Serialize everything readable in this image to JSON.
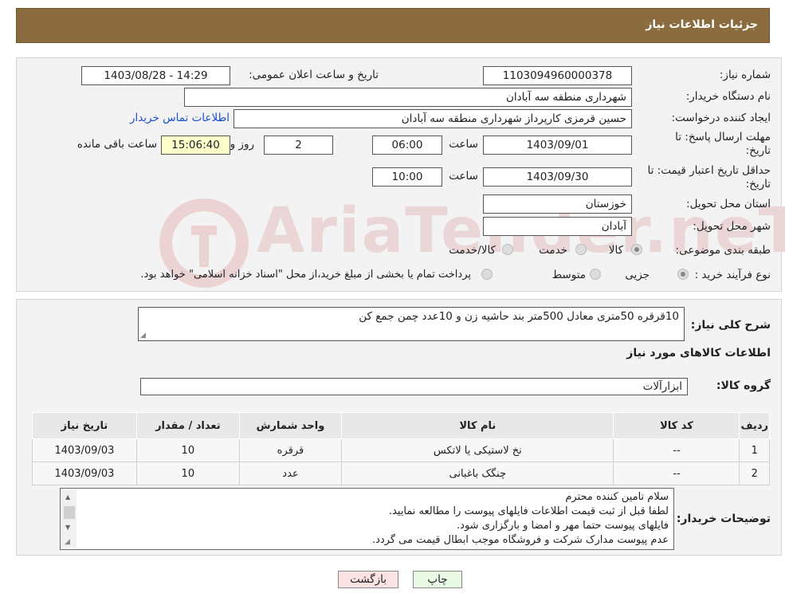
{
  "header": {
    "title": "جزئیات اطلاعات نیاز"
  },
  "watermark": {
    "text": "AriaTender.neT"
  },
  "form": {
    "need_number_label": "شماره نیاز:",
    "need_number": "1103094960000378",
    "announce_label": "تاریخ و ساعت اعلان عمومی:",
    "announce_value": "1403/08/28 - 14:29",
    "buyer_org_label": "نام دستگاه خریدار:",
    "buyer_org": "شهرداری منطقه سه آبادان",
    "requester_label": "ایجاد کننده درخواست:",
    "requester": "حسین قرمزی کارپرداز شهرداری منطقه سه آبادان",
    "contact_link": "اطلاعات تماس خریدار",
    "reply_deadline_label": "مهلت ارسال پاسخ: تا تاریخ:",
    "reply_date": "1403/09/01",
    "time_label": "ساعت",
    "reply_time": "06:00",
    "days": "2",
    "days_label": "روز و",
    "remaining_time": "15:06:40",
    "remaining_label": "ساعت باقی مانده",
    "price_validity_label": "حداقل تاریخ اعتبار قیمت: تا تاریخ:",
    "price_date": "1403/09/30",
    "price_time": "10:00",
    "province_label": "استان محل تحویل:",
    "province": "خوزستان",
    "city_label": "شهر محل تحویل:",
    "city": "آبادان",
    "category_label": "طبقه بندی موضوعی:",
    "category_options": [
      "کالا",
      "خدمت",
      "کالا/خدمت"
    ],
    "category_selected": "کالا",
    "process_label": "نوع فرآیند خرید :",
    "process_options": [
      "جزیی",
      "متوسط"
    ],
    "process_selected": "جزیی",
    "process_note": "پرداخت تمام یا بخشی از مبلغ خرید،از محل \"اسناد خزانه اسلامی\" خواهد بود."
  },
  "details": {
    "general_desc_label": "شرح کلی نیاز:",
    "general_desc": "10قرقره 50متری معادل 500متر بند حاشیه زن و 10عدد چمن جمع کن",
    "goods_info_title": "اطلاعات کالاهای مورد نیاز",
    "goods_group_label": "گروه کالا:",
    "goods_group": "ابزارآلات",
    "table_headers": [
      "ردیف",
      "کد کالا",
      "نام کالا",
      "واحد شمارش",
      "تعداد / مقدار",
      "تاریخ نیاز"
    ],
    "rows": [
      [
        "1",
        "--",
        "نخ لاستیکی یا لاتکس",
        "قرقره",
        "10",
        "1403/09/03"
      ],
      [
        "2",
        "--",
        "چنگک باغبانی",
        "عدد",
        "10",
        "1403/09/03"
      ]
    ],
    "buyer_notes_label": "توضیحات خریدار:",
    "buyer_notes": [
      "سلام تامین کننده محترم",
      "لطفا قبل از ثبت قیمت اطلاعات فایلهای پیوست را مطالعه نمایید.",
      "فایلهای پیوست حتما مهر و امضا و بارگزاری شود.",
      "عدم پیوست مدارک شرکت و فروشگاه موجب ابطال قیمت می گردد."
    ]
  },
  "buttons": {
    "print": "چاپ",
    "back": "بازگشت"
  }
}
